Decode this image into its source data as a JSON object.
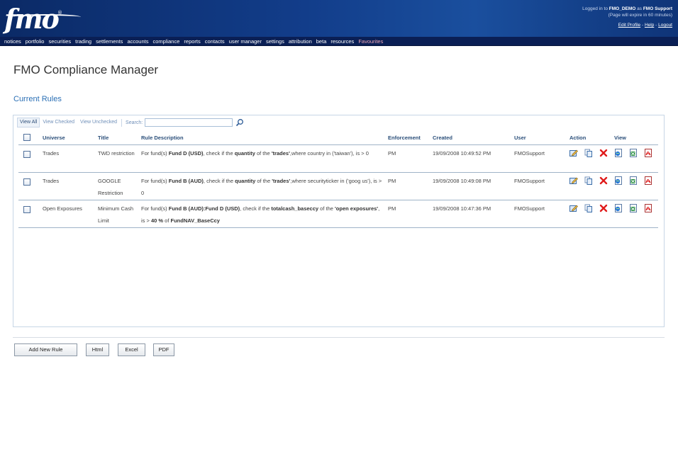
{
  "header": {
    "logo_text": "fmo",
    "logged_in_prefix": "Logged in to",
    "account": "FMO_DEMO",
    "at_word": "as",
    "user": "FMO Support",
    "expiry_note": "(Page will expire in 60 minutes)",
    "edit_profile": "Edit Profile",
    "help": "Help",
    "logout": "Logout",
    "link_sep": "-"
  },
  "nav": {
    "items": [
      "notices",
      "portfolio",
      "securities",
      "trading",
      "settlements",
      "accounts",
      "compliance",
      "reports",
      "contacts",
      "user manager",
      "settings",
      "attribution",
      "beta",
      "resources",
      "Favourites"
    ]
  },
  "page": {
    "title": "FMO Compliance Manager",
    "section": "Current Rules"
  },
  "filters": {
    "view_all": "View All",
    "view_checked": "View Checked",
    "view_unchecked": "View Unchecked",
    "search_label": "Search:",
    "search_value": ""
  },
  "table": {
    "headers": {
      "universe": "Universe",
      "title": "Title",
      "description": "Rule Description",
      "enforcement": "Enforcement",
      "created": "Created",
      "user": "User",
      "action": "Action",
      "view": "View"
    },
    "rows": [
      {
        "universe": "Trades",
        "title": "TWD restriction",
        "d1": "For fund(s) ",
        "d2": "Fund D (USD)",
        "d3": ", check if the ",
        "d4": "quantity",
        "d5": " of the ",
        "d6": "'trades'",
        "d7": ",where country in ('taiwan'), is > 0",
        "d8": "",
        "d9": "",
        "d10": "",
        "enforcement": "PM",
        "created": "19/09/2008 10:49:52 PM",
        "user": "FMOSupport"
      },
      {
        "universe": "Trades",
        "title": "GOOGLE Restriction",
        "d1": "For fund(s) ",
        "d2": "Fund B (AUD)",
        "d3": ", check if the ",
        "d4": "quantity",
        "d5": " of the ",
        "d6": "'trades'",
        "d7": ",where securityticker in ('goog us'), is > 0",
        "d8": "",
        "d9": "",
        "d10": "",
        "enforcement": "PM",
        "created": "19/09/2008 10:49:08 PM",
        "user": "FMOSupport"
      },
      {
        "universe": "Open Exposures",
        "title": "Minimum Cash Limit",
        "d1": "For fund(s) ",
        "d2": "Fund B (AUD):Fund D (USD)",
        "d3": ", check if the ",
        "d4": "totalcash_baseccy",
        "d5": " of the ",
        "d6": "'open exposures'",
        "d7": ", is > ",
        "d8": "40 %",
        "d9": " of ",
        "d10": "FundNAV_BaseCcy",
        "enforcement": "PM",
        "created": "19/09/2008 10:47:36 PM",
        "user": "FMOSupport"
      }
    ]
  },
  "buttons": {
    "add": "Add New Rule",
    "html": "Html",
    "excel": "Excel",
    "pdf": "PDF"
  }
}
